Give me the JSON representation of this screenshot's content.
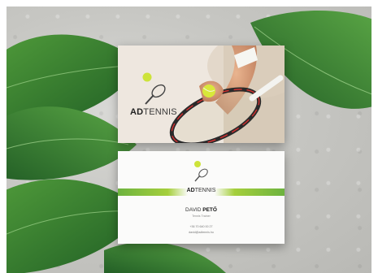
{
  "brand": {
    "prefix": "AD",
    "suffix": "TENNIS"
  },
  "person": {
    "first_name": "DAVID",
    "last_name": "PETŐ",
    "role": "Tennis Trainer",
    "phone": "+36 70 640 00 27",
    "email": "david@adtennis.hu"
  },
  "colors": {
    "accent_green": "#a5cf3c",
    "ball_yellow": "#d8e83a",
    "leaf_green": "#2f7d32",
    "background_stone": "#c7c7c3"
  },
  "icons": [
    "tennis-racket-icon",
    "tennis-ball-icon"
  ]
}
